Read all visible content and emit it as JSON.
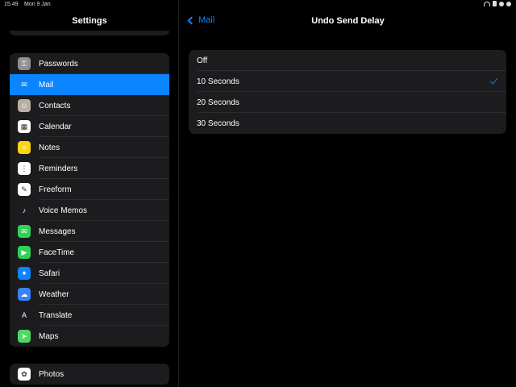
{
  "status": {
    "time": "15.49",
    "date": "Mon 9 Jan"
  },
  "sidebar": {
    "title": "Settings",
    "items": [
      {
        "label": "Passwords",
        "icon": "key-icon",
        "color": "#8e8e93",
        "glyph": "⚿"
      },
      {
        "label": "Mail",
        "icon": "mail-icon",
        "color": "#0a84ff",
        "glyph": "✉",
        "selected": true
      },
      {
        "label": "Contacts",
        "icon": "contacts-icon",
        "color": "#b8b0a4",
        "glyph": "☺"
      },
      {
        "label": "Calendar",
        "icon": "calendar-icon",
        "color": "#ffffff",
        "glyph": "▦"
      },
      {
        "label": "Notes",
        "icon": "notes-icon",
        "color": "#ffd60a",
        "glyph": "≡"
      },
      {
        "label": "Reminders",
        "icon": "reminders-icon",
        "color": "#ffffff",
        "glyph": "⋮"
      },
      {
        "label": "Freeform",
        "icon": "freeform-icon",
        "color": "#ffffff",
        "glyph": "✎"
      },
      {
        "label": "Voice Memos",
        "icon": "voice-memos-icon",
        "color": "#1c1c1e",
        "glyph": "♪"
      },
      {
        "label": "Messages",
        "icon": "messages-icon",
        "color": "#30d158",
        "glyph": "✉"
      },
      {
        "label": "FaceTime",
        "icon": "facetime-icon",
        "color": "#30d158",
        "glyph": "▶"
      },
      {
        "label": "Safari",
        "icon": "safari-icon",
        "color": "#0a84ff",
        "glyph": "✦"
      },
      {
        "label": "Weather",
        "icon": "weather-icon",
        "color": "#3a82f7",
        "glyph": "☁"
      },
      {
        "label": "Translate",
        "icon": "translate-icon",
        "color": "#1c1c1e",
        "glyph": "A"
      },
      {
        "label": "Maps",
        "icon": "maps-icon",
        "color": "#4cd964",
        "glyph": "➤"
      }
    ],
    "items2": [
      {
        "label": "Photos",
        "icon": "photos-icon",
        "color": "#ffffff",
        "glyph": "✿"
      }
    ]
  },
  "main": {
    "back_label": "Mail",
    "title": "Undo Send Delay",
    "options": [
      {
        "label": "Off",
        "checked": false
      },
      {
        "label": "10 Seconds",
        "checked": true
      },
      {
        "label": "20 Seconds",
        "checked": false
      },
      {
        "label": "30 Seconds",
        "checked": false
      }
    ],
    "accent": "#0a84ff"
  }
}
